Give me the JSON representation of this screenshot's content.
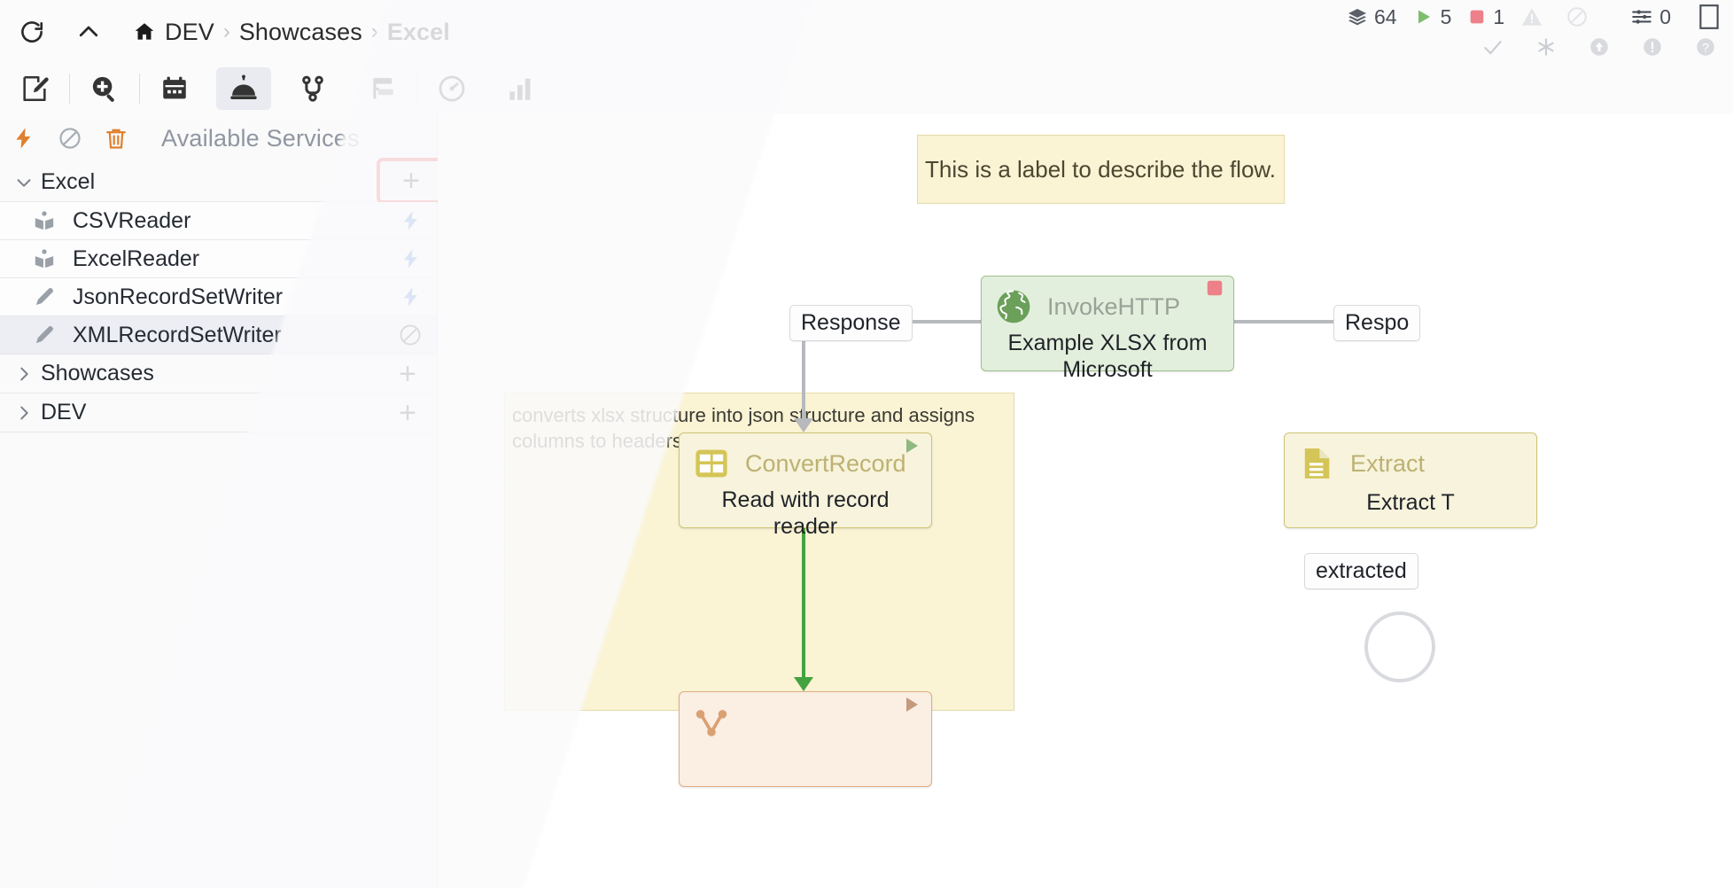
{
  "breadcrumb": {
    "home_icon": "home-icon",
    "refresh_icon": "refresh-icon",
    "up_icon": "chevron-up-icon",
    "items": [
      {
        "label": "DEV",
        "active": false
      },
      {
        "label": "Showcases",
        "active": false
      },
      {
        "label": "Excel",
        "active": true
      }
    ],
    "separator": "›"
  },
  "status_bar": {
    "stats": [
      {
        "icon": "layers-icon",
        "value": "64"
      },
      {
        "icon": "play-icon",
        "value": "5"
      },
      {
        "icon": "stop-square-icon",
        "value": "1"
      },
      {
        "icon": "warning-triangle-icon",
        "value": ""
      },
      {
        "icon": "no-entry-icon",
        "value": ""
      }
    ],
    "second_row": [
      {
        "icon": "check-icon"
      },
      {
        "icon": "asterisk-icon"
      },
      {
        "icon": "upload-circle-icon"
      },
      {
        "icon": "exclamation-circle-icon"
      },
      {
        "icon": "question-circle-icon"
      }
    ],
    "settings": {
      "icon": "sliders-icon",
      "value": "0"
    },
    "panel_icon": "panel-icon"
  },
  "toolbar": {
    "items": [
      {
        "name": "edit-document-icon",
        "active": false
      },
      {
        "name": "search-plus-icon",
        "active": false
      },
      {
        "name": "calendar-icon",
        "active": false
      },
      {
        "name": "service-bell-icon",
        "active": true
      },
      {
        "name": "git-branch-icon",
        "active": false
      },
      {
        "name": "hierarchy-icon",
        "active": false
      },
      {
        "name": "gauge-icon",
        "active": false
      },
      {
        "name": "bar-chart-icon",
        "active": false
      }
    ]
  },
  "left_panel": {
    "header": {
      "title": "Available Services",
      "actions": [
        {
          "name": "enable-all-icon",
          "glyph": "lightning",
          "color": "#e0802f"
        },
        {
          "name": "disable-all-icon",
          "glyph": "no-entry",
          "color": "#9aa0a8"
        },
        {
          "name": "delete-icon",
          "glyph": "trash",
          "color": "#e0802f"
        }
      ]
    },
    "groups": [
      {
        "name": "Excel",
        "expanded": true,
        "add_label": "+",
        "add_highlighted": true,
        "services": [
          {
            "name": "CSVReader",
            "icon": "book-icon",
            "state_icon": "lightning-icon",
            "state": "enabled",
            "selected": false
          },
          {
            "name": "ExcelReader",
            "icon": "book-icon",
            "state_icon": "lightning-icon",
            "state": "enabled",
            "selected": false
          },
          {
            "name": "JsonRecordSetWriter",
            "icon": "pencil-icon",
            "state_icon": "lightning-icon",
            "state": "enabled",
            "selected": false
          },
          {
            "name": "XMLRecordSetWriter",
            "icon": "pencil-icon",
            "state_icon": "no-entry-icon",
            "state": "disabled",
            "selected": true
          }
        ]
      },
      {
        "name": "Showcases",
        "expanded": false,
        "add_label": "+",
        "add_highlighted": false,
        "services": []
      },
      {
        "name": "DEV",
        "expanded": false,
        "add_label": "+",
        "add_highlighted": false,
        "services": []
      }
    ]
  },
  "canvas": {
    "flow_label": "This is a label to describe the flow.",
    "comment": "converts xlsx structure into json  structure and assigns columns to headers",
    "nodes": [
      {
        "id": "invokehttp",
        "type": "InvokeHTTP",
        "name": "Example XLSX from Microsoft",
        "icon": "globe-icon",
        "status_icon": "stop-square-icon",
        "color": "#e3efdd",
        "border": "#9fc08c"
      },
      {
        "id": "convertrecord",
        "type": "ConvertRecord",
        "name": "Read with record reader",
        "icon": "table-icon",
        "status_icon": "play-icon",
        "color": "#f7f3dc",
        "border": "#cfc478"
      },
      {
        "id": "extracttext",
        "type": "Extract",
        "name": "Extract T",
        "icon": "document-lines-icon",
        "status_icon": "",
        "color": "#f7f3dc",
        "border": "#cfc478"
      },
      {
        "id": "bottomproc",
        "type": "",
        "name": "",
        "icon": "route-icon",
        "status_icon": "play-icon",
        "color": "#fbeee3",
        "border": "#dfae85"
      }
    ],
    "connections": [
      {
        "label": "Response",
        "id": "conn-response-left"
      },
      {
        "label": "Respo",
        "id": "conn-response-right"
      },
      {
        "label": "extracted",
        "id": "conn-extracted"
      }
    ]
  }
}
